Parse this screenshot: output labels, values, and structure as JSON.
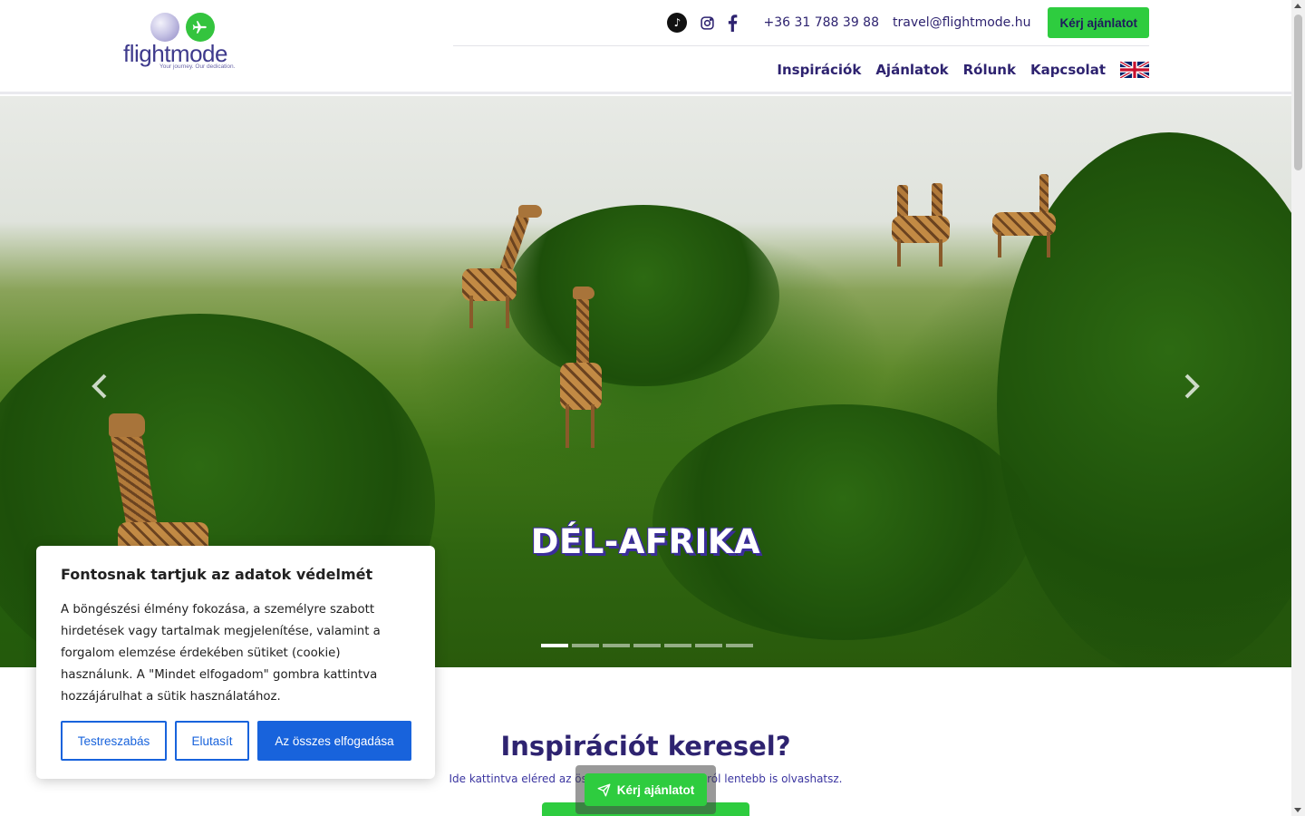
{
  "brand": {
    "name": "flightmode",
    "tagline": "Your journey. Our dedication.",
    "colors": {
      "primary": "#2e2370",
      "accent_green": "#2ecc3f",
      "cookie_blue": "#1863dc"
    }
  },
  "topbar": {
    "social_icons": [
      "tiktok-icon",
      "instagram-icon",
      "facebook-icon"
    ],
    "phone": "+36 31 788 39 88",
    "email": "travel@flightmode.hu",
    "quote_button": "Kérj ajánlatot"
  },
  "nav": {
    "items": [
      "Inspirációk",
      "Ajánlatok",
      "Rólunk",
      "Kapcsolat"
    ],
    "language_flag": "uk-flag-icon"
  },
  "hero": {
    "slide_title": "DÉL-AFRIKA",
    "slide_count": 7,
    "active_slide": 1
  },
  "inspiration": {
    "title": "Inspirációt keresel?",
    "subtitle": "Ide kattintva eléred az összes bej... kalandjainkról lentebb is olvashatsz."
  },
  "floating_cta": {
    "label": "Kérj ajánlatot"
  },
  "cookie_banner": {
    "title": "Fontosnak tartjuk az adatok védelmét",
    "text": "A böngészési élmény fokozása, a személyre szabott hirdetések vagy tartalmak megjelenítése, valamint a forgalom elemzése érdekében sütiket (cookie) használunk. A \"Mindet elfogadom\" gombra kattintva hozzájárulhat a sütik használatához.",
    "customize": "Testreszabás",
    "reject": "Elutasít",
    "accept_all": "Az összes elfogadása"
  }
}
